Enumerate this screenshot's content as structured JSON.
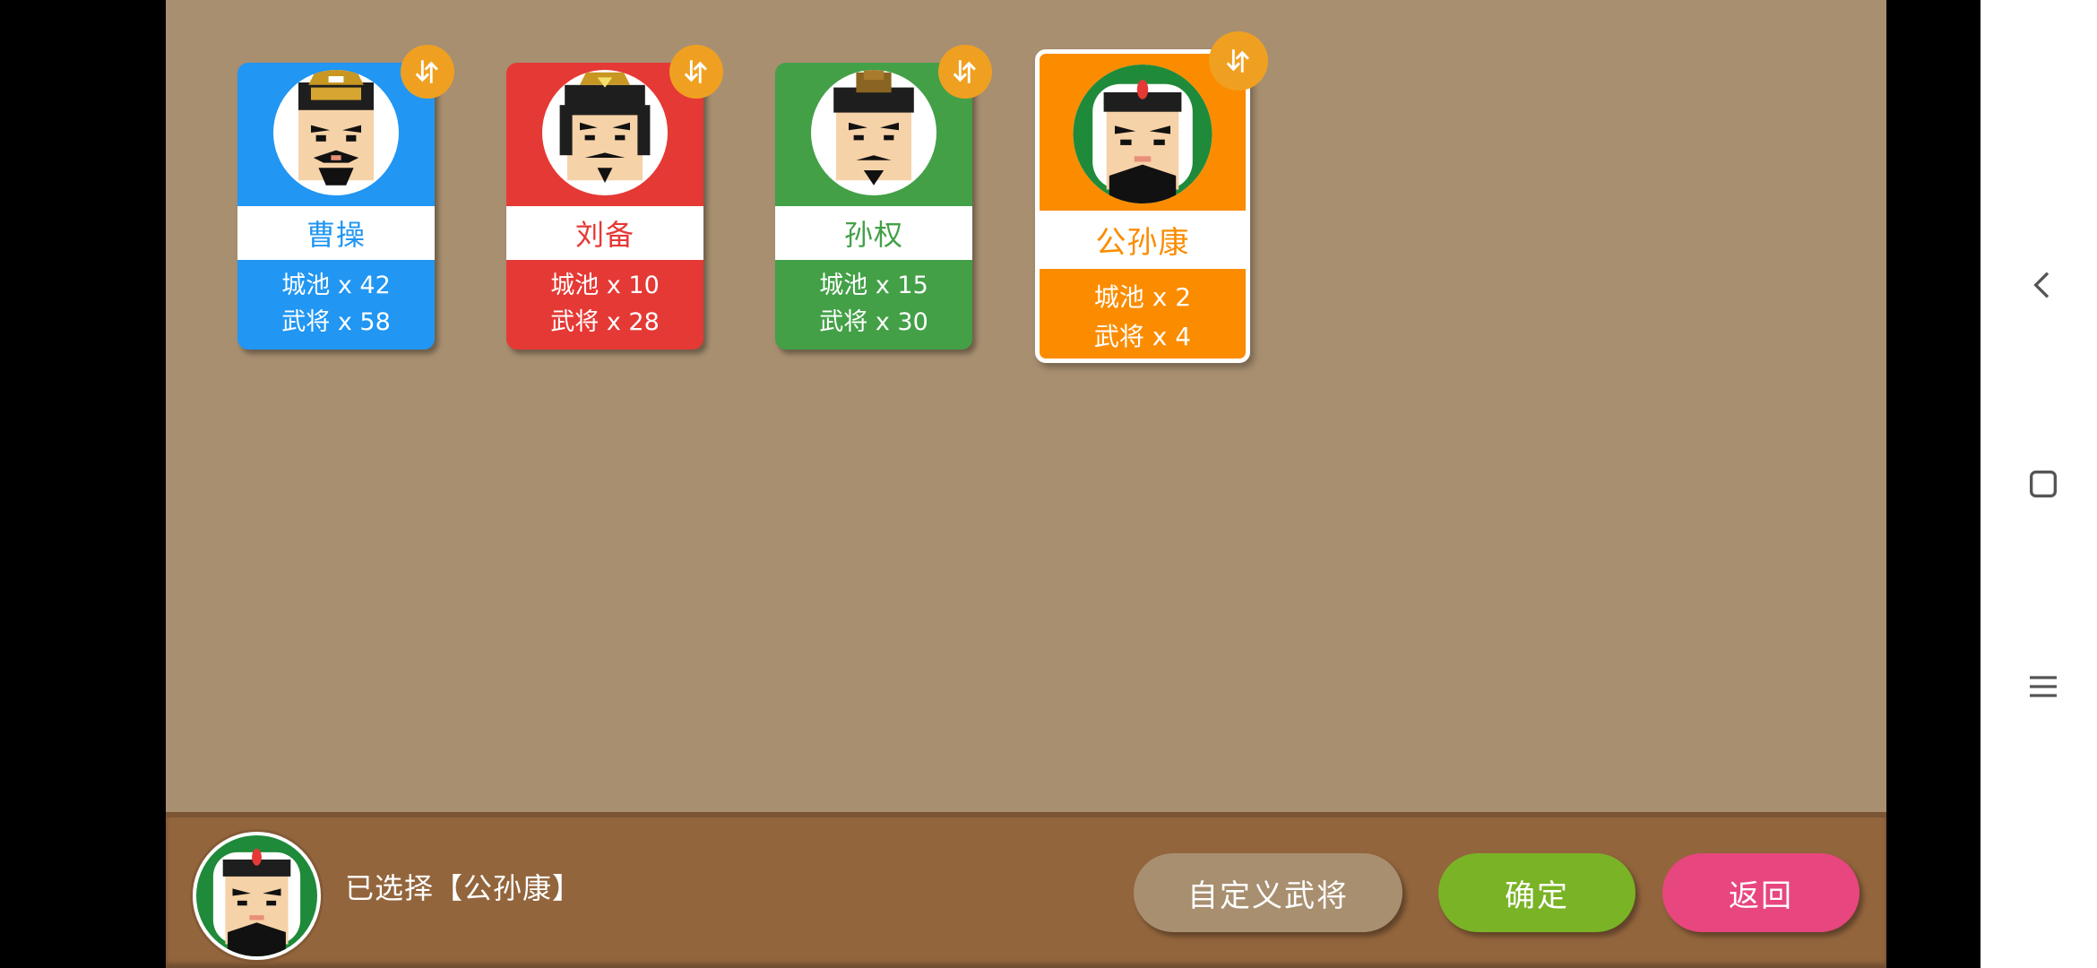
{
  "cards": [
    {
      "name": "曹操",
      "cities": "城池 x 42",
      "generals": "武将 x 58",
      "color": "#2196f3",
      "name_color": "#2196f3"
    },
    {
      "name": "刘备",
      "cities": "城池 x 10",
      "generals": "武将 x 28",
      "color": "#e53935",
      "name_color": "#e53935"
    },
    {
      "name": "孙权",
      "cities": "城池 x 15",
      "generals": "武将 x 30",
      "color": "#43a047",
      "name_color": "#43a047"
    },
    {
      "name": "公孙康",
      "cities": "城池 x 2",
      "generals": "武将 x 4",
      "color": "#fb8c00",
      "name_color": "#fb8c00",
      "selected": true
    }
  ],
  "bottom": {
    "selected_text": "已选择【公孙康】",
    "custom_label": "自定义武将",
    "confirm_label": "确定",
    "back_label": "返回"
  },
  "colors": {
    "background": "#a88f70",
    "bar": "#93653d",
    "badge": "#f0a020",
    "confirm": "#7ab326",
    "back": "#e7467e"
  },
  "icons": {
    "badge": "swap-vertical-icon",
    "nav_back": "chevron-left-icon",
    "nav_home": "square-icon",
    "nav_menu": "hamburger-icon"
  }
}
